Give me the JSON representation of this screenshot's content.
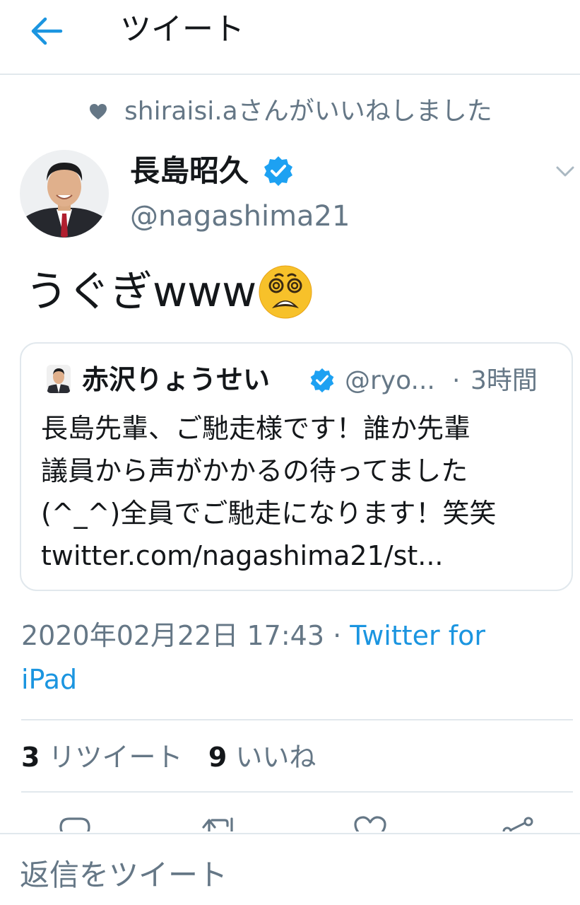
{
  "colors": {
    "accent": "#1b95e0",
    "verified": "#1da1f2",
    "muted": "#657786",
    "text": "#14171a",
    "border": "#e1e8ed"
  },
  "header": {
    "title": "ツイート",
    "back_icon": "arrow-left-icon"
  },
  "social_context": {
    "text": "shiraisi.aさんがいいねしました",
    "icon": "heart-icon"
  },
  "tweet": {
    "author_name": "長島昭久",
    "author_handle": "@nagashima21",
    "text": "うぐぎwww",
    "emoji": "dizzy-face-emoji",
    "timestamp": "2020年02月22日 17:43",
    "separator": "·",
    "source_line1": "Twitter for",
    "source_line2": "iPad"
  },
  "quote": {
    "author_name": "赤沢りょうせい",
    "author_handle": "@ryo...",
    "separator": "·",
    "time": "3時間",
    "lines": [
      "長島先輩、ご馳走様です！誰か先輩",
      "議員から声がかかるの待ってました",
      "(^_^)全員でご馳走になります！笑笑",
      "twitter.com/nagashima21/st..."
    ]
  },
  "stats": {
    "retweet_count": "3",
    "retweet_label": "リツイート",
    "like_count": "9",
    "like_label": "いいね"
  },
  "actions": [
    "reply-icon",
    "retweet-icon",
    "like-icon",
    "share-icon"
  ],
  "reply": {
    "placeholder": "返信をツイート"
  }
}
